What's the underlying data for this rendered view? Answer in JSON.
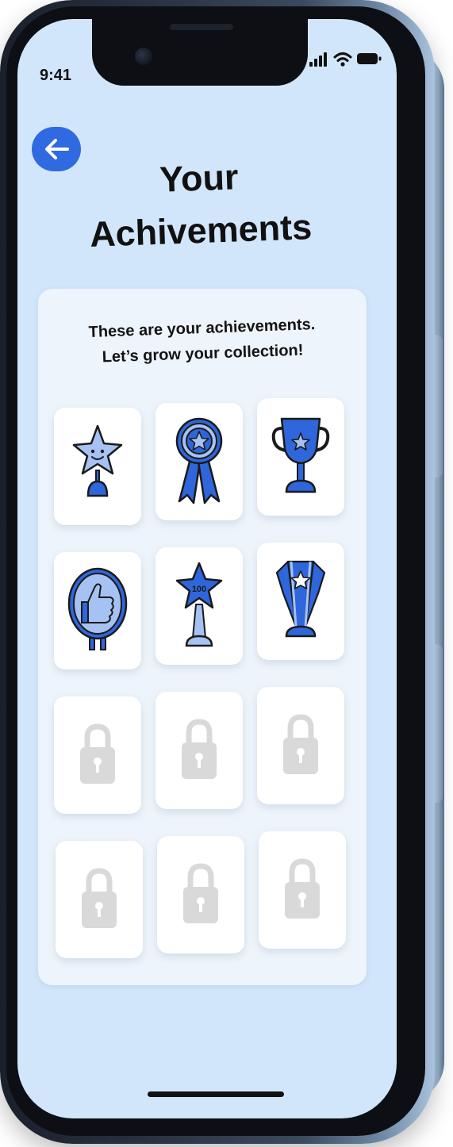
{
  "status_bar": {
    "time": "9:41",
    "icons": [
      "signal-icon",
      "wifi-icon",
      "battery-icon"
    ]
  },
  "header": {
    "back_icon": "arrow-left-icon",
    "title_line1": "Your",
    "title_line2": "Achivements"
  },
  "intro": {
    "line1": "These are your achievements.",
    "line2": "Let’s grow your collection!"
  },
  "achievements": [
    {
      "name": "smiling-star-award",
      "unlocked": true
    },
    {
      "name": "rosette-ribbon",
      "unlocked": true
    },
    {
      "name": "trophy-cup",
      "unlocked": true
    },
    {
      "name": "thumbs-up-badge",
      "unlocked": true
    },
    {
      "name": "star-100-trophy",
      "unlocked": true,
      "label": "100"
    },
    {
      "name": "crystal-star-trophy",
      "unlocked": true
    },
    {
      "name": "lock",
      "unlocked": false
    },
    {
      "name": "lock",
      "unlocked": false
    },
    {
      "name": "lock",
      "unlocked": false
    },
    {
      "name": "lock",
      "unlocked": false
    },
    {
      "name": "lock",
      "unlocked": false
    },
    {
      "name": "lock",
      "unlocked": false
    }
  ],
  "colors": {
    "accent": "#2f6ae0",
    "screen_bg": "#d2e6fb",
    "card_bg": "#eef4fb",
    "icon_blue": "#2f66db",
    "icon_light": "#a6c2f2",
    "lock_grey": "#d9d9d9"
  }
}
